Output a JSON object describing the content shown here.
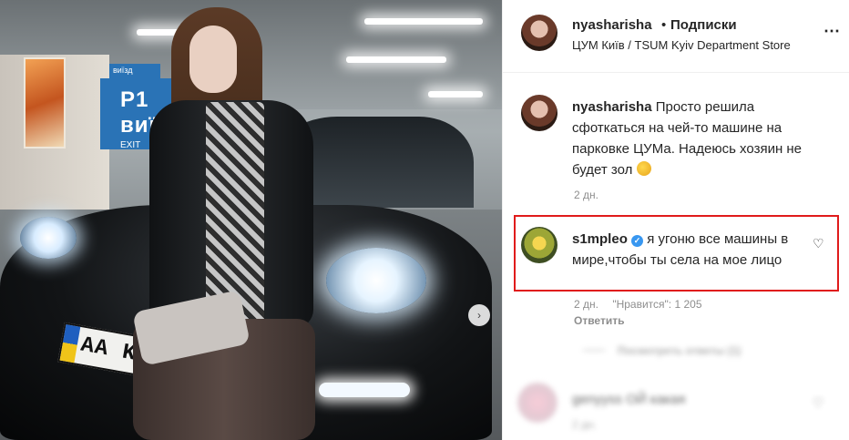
{
  "post": {
    "author": "nyasharisha",
    "separator": "•",
    "follow_label": "Подписки",
    "location": "ЦУМ Київ / TSUM Kyiv Department Store",
    "more_icon": "⋯"
  },
  "photo": {
    "sign_small": "виїзд",
    "sign_big": "P1 виїзд",
    "sign_exit": "EXIT",
    "plate_text": "AA KE",
    "nav_icon": "›"
  },
  "caption": {
    "username": "nyasharisha",
    "text": "Просто решила сфоткаться на чей-то машине на парковке ЦУМа. Надеюсь хозяин не будет зол",
    "time": "2 дн."
  },
  "highlighted_comment": {
    "username": "s1mpleo",
    "verified_icon": "✓",
    "text": "я угоню все машины в мире,чтобы ты села на мое лицо",
    "time": "2 дн.",
    "likes": "\"Нравится\": 1 205",
    "reply_label": "Ответить",
    "heart_icon": "♡"
  },
  "more_comments": {
    "view_replies": "Посмотреть ответы (1)",
    "comment2_text": "genyyss ОЙ какая",
    "comment2_time": "2 дн.",
    "heart_icon": "♡"
  },
  "colors": {
    "highlight_border": "#e01b1b",
    "verified": "#3897f0",
    "muted_text": "#8e8e8e"
  }
}
